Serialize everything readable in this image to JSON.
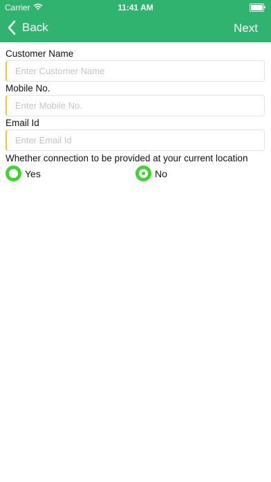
{
  "status_bar": {
    "carrier": "Carrier",
    "time": "11:41 AM"
  },
  "nav": {
    "back_label": "Back",
    "next_label": "Next"
  },
  "form": {
    "customer_name": {
      "label": "Customer Name",
      "placeholder": "Enter Customer Name",
      "value": ""
    },
    "mobile": {
      "label": "Mobile No.",
      "placeholder": "Enter Mobile No.",
      "value": ""
    },
    "email": {
      "label": "Email Id",
      "placeholder": "Enter Email Id",
      "value": ""
    },
    "connection_question": "Whether connection to be provided at your current location",
    "options": [
      {
        "label": "Yes",
        "selected": false
      },
      {
        "label": "No",
        "selected": true
      }
    ]
  },
  "colors": {
    "header": "#2fb36e",
    "radio": "#3fd432",
    "field_accent": "#f4c430"
  }
}
